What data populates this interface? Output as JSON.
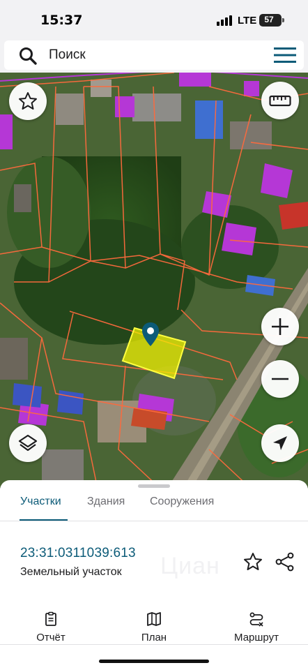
{
  "status_bar": {
    "time": "15:37",
    "network": "LTE",
    "battery": "57"
  },
  "search": {
    "placeholder": "Поиск",
    "icon": "search-icon",
    "menu_icon": "hamburger-menu-icon"
  },
  "map": {
    "buttons": {
      "favorites": "star-icon",
      "ruler": "ruler-icon",
      "layers": "layers-icon",
      "zoom_in": "plus-icon",
      "zoom_out": "minus-icon",
      "locate": "navigation-arrow-icon"
    },
    "colors": {
      "parcel_border": "#ff6a3d",
      "selected_parcel": "#f4f400",
      "building_fill": "#b537d6",
      "pin": "#0c5b78"
    }
  },
  "sheet": {
    "tabs": [
      {
        "label": "Участки",
        "active": true
      },
      {
        "label": "Здания",
        "active": false
      },
      {
        "label": "Сооружения",
        "active": false
      }
    ],
    "parcel": {
      "cadastral_number": "23:31:0311039:613",
      "type": "Земельный участок",
      "watermark": "Циан"
    }
  },
  "bottom_nav": [
    {
      "label": "Отчёт",
      "icon": "report-icon"
    },
    {
      "label": "План",
      "icon": "map-icon"
    },
    {
      "label": "Маршрут",
      "icon": "route-icon"
    }
  ],
  "accent_color": "#0c5b78"
}
